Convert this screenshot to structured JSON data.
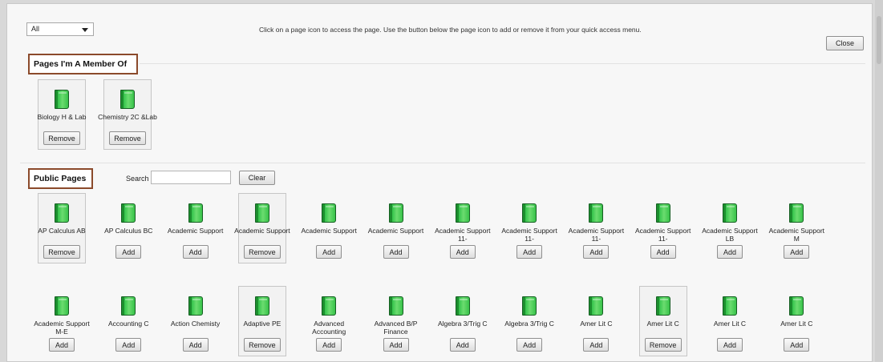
{
  "filter": {
    "selected": "All"
  },
  "instructions": "Click on a page icon to access the page. Use the button below the page icon to add or remove it from your quick access menu.",
  "close_label": "Close",
  "members": {
    "title": "Pages I'm A Member Of",
    "items": [
      {
        "name": "Biology H & Lab",
        "action": "Remove"
      },
      {
        "name": "Chemistry 2C &Lab",
        "action": "Remove"
      }
    ]
  },
  "public": {
    "title": "Public Pages",
    "search_label": "Search",
    "search_value": "",
    "clear_label": "Clear",
    "rows": [
      [
        {
          "name": "AP Calculus AB",
          "action": "Remove",
          "member": true
        },
        {
          "name": "AP Calculus BC",
          "action": "Add",
          "member": false
        },
        {
          "name": "Academic Support",
          "action": "Add",
          "member": false
        },
        {
          "name": "Academic Support",
          "action": "Remove",
          "member": true
        },
        {
          "name": "Academic Support",
          "action": "Add",
          "member": false
        },
        {
          "name": "Academic Support",
          "action": "Add",
          "member": false
        },
        {
          "name": "Academic Support 11-",
          "action": "Add",
          "member": false
        },
        {
          "name": "Academic Support 11-",
          "action": "Add",
          "member": false
        },
        {
          "name": "Academic Support 11-",
          "action": "Add",
          "member": false
        },
        {
          "name": "Academic Support 11-",
          "action": "Add",
          "member": false
        },
        {
          "name": "Academic Support LB",
          "action": "Add",
          "member": false
        },
        {
          "name": "Academic Support M",
          "action": "Add",
          "member": false
        }
      ],
      [
        {
          "name": "Academic Support M-E",
          "action": "Add",
          "member": false
        },
        {
          "name": "Accounting C",
          "action": "Add",
          "member": false
        },
        {
          "name": "Action Chemisty",
          "action": "Add",
          "member": false
        },
        {
          "name": "Adaptive PE",
          "action": "Remove",
          "member": true
        },
        {
          "name": "Advanced Accounting",
          "action": "Add",
          "member": false
        },
        {
          "name": "Advanced B/P Finance",
          "action": "Add",
          "member": false
        },
        {
          "name": "Algebra 3/Trig C",
          "action": "Add",
          "member": false
        },
        {
          "name": "Algebra 3/Trig C",
          "action": "Add",
          "member": false
        },
        {
          "name": "Amer Lit C",
          "action": "Add",
          "member": false
        },
        {
          "name": "Amer Lit C",
          "action": "Remove",
          "member": true
        },
        {
          "name": "Amer Lit C",
          "action": "Add",
          "member": false
        },
        {
          "name": "Amer Lit C",
          "action": "Add",
          "member": false
        }
      ]
    ]
  }
}
